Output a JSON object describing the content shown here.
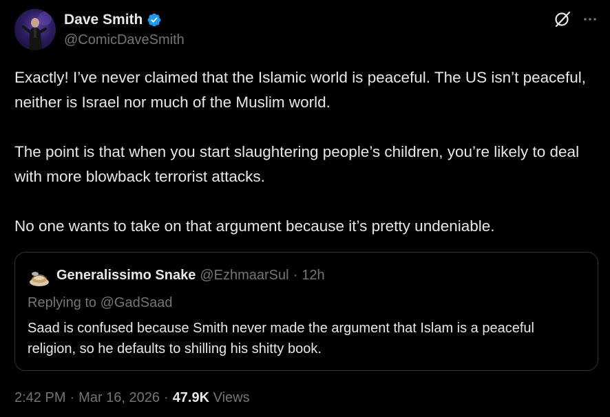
{
  "author": {
    "display_name": "Dave Smith",
    "handle": "@ComicDaveSmith",
    "verified": true,
    "avatar": "avatar-icon"
  },
  "icons": {
    "verified": "verified-badge-icon",
    "grok": "grok-icon",
    "more": "more-options-icon"
  },
  "tweet": {
    "paragraphs": [
      "Exactly! I’ve never claimed that the Islamic world is peaceful. The US isn’t peaceful, neither is Israel nor much of the  Muslim world.",
      "The point is that when you start slaughtering people’s children, you’re likely to deal with more blowback terrorist attacks.",
      "No one wants to take on that argument because it’s pretty undeniable."
    ]
  },
  "quote": {
    "display_name": "Generalissimo Snake",
    "handle": "@EzhmaarSul",
    "separator": "·",
    "time": "12h",
    "replying_prefix": "Replying to ",
    "replying_to": "@GadSaad",
    "text": "Saad is confused because Smith never made the argument that Islam is a peaceful religion, so he defaults to shilling his shitty book."
  },
  "meta": {
    "time": "2:42 PM",
    "date": "Mar 16, 2026",
    "separator": "·",
    "views_count": "47.9K",
    "views_label": "Views"
  },
  "colors": {
    "background": "#000000",
    "text": "#e7e9ea",
    "secondary": "#71767b",
    "border": "#2f3336",
    "verified": "#1d9bf0"
  }
}
